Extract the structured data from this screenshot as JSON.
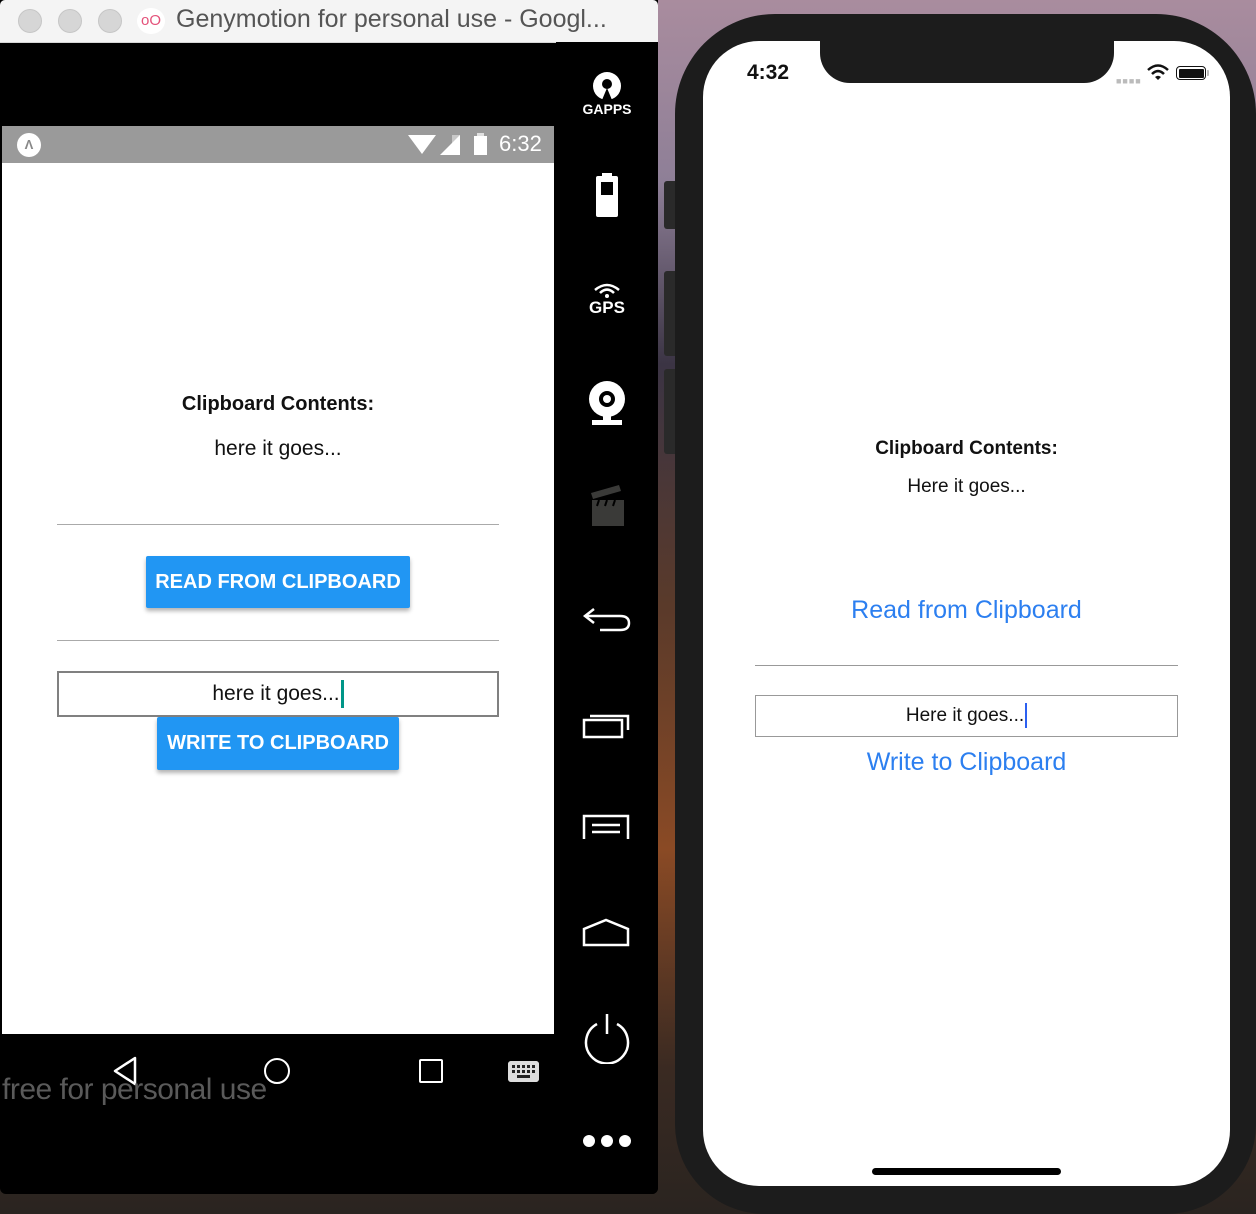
{
  "genymotion": {
    "window_title": "Genymotion for personal use - Googl...",
    "app_logo": "oO",
    "watermark": "free for personal use",
    "side_panel": [
      {
        "icon": "gapps-icon",
        "label": "GAPPS"
      },
      {
        "icon": "battery-icon",
        "label": ""
      },
      {
        "icon": "gps-icon",
        "label": "GPS"
      },
      {
        "icon": "webcam-icon",
        "label": ""
      },
      {
        "icon": "clapperboard-icon",
        "label": ""
      },
      {
        "icon": "back-icon",
        "label": ""
      },
      {
        "icon": "recent-apps-icon",
        "label": ""
      },
      {
        "icon": "menu-icon",
        "label": ""
      },
      {
        "icon": "home-icon",
        "label": ""
      },
      {
        "icon": "power-icon",
        "label": ""
      },
      {
        "icon": "more-icon",
        "label": ""
      }
    ]
  },
  "android": {
    "status_bar": {
      "time": "6:32",
      "app_icon": "expo-icon"
    },
    "title": "Clipboard Contents:",
    "clipboard_content": "here it goes...",
    "read_button": "READ FROM CLIPBOARD",
    "input_value": "here it goes...",
    "write_button": "WRITE TO CLIPBOARD",
    "accent_color": "#2196f3",
    "nav_bar": [
      "back-icon",
      "home-icon",
      "recent-apps-icon",
      "keyboard-icon"
    ]
  },
  "ios": {
    "status_bar": {
      "time": "4:32"
    },
    "title": "Clipboard Contents:",
    "clipboard_content": "Here it goes...",
    "read_button": "Read from Clipboard",
    "input_value": "Here it goes...",
    "write_button": "Write to Clipboard",
    "accent_color": "#2c7ff0"
  }
}
